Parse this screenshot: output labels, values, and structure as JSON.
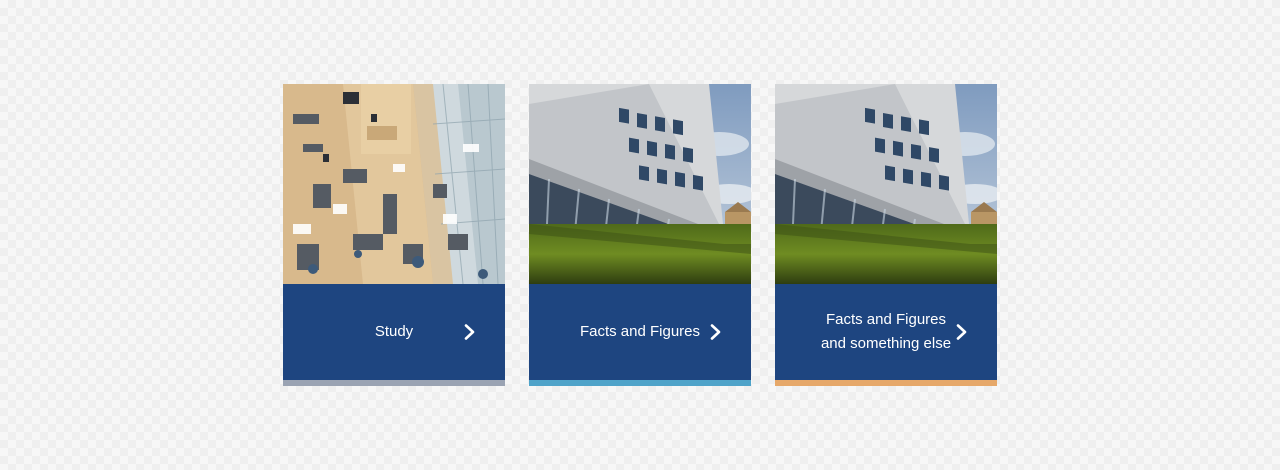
{
  "cards": [
    {
      "label": "Study",
      "image": "library-interior-photo",
      "accent_color": "#9aa3b3"
    },
    {
      "label": "Facts and Figures",
      "image": "university-building-photo",
      "accent_color": "#4fa3c9"
    },
    {
      "label": "Facts and Figures and something else",
      "image": "university-building-photo",
      "accent_color": "#e6a86a"
    }
  ],
  "colors": {
    "card_footer": "#1e4580",
    "label_text": "#ffffff"
  },
  "icons": {
    "chevron": "chevron-right-icon"
  }
}
